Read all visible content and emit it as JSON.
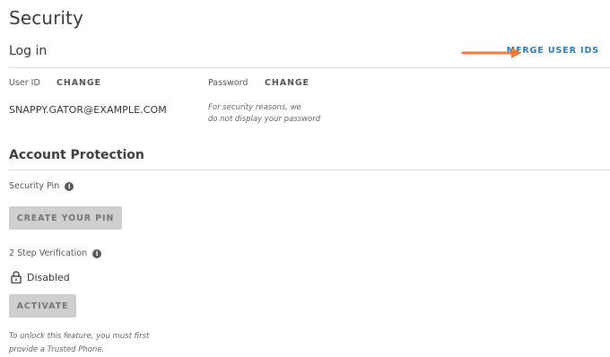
{
  "page": {
    "title": "Security"
  },
  "login": {
    "title": "Log in",
    "merge_link": "MERGE USER IDS",
    "user_id_label": "User ID",
    "user_id_change": "CHANGE",
    "password_label": "Password",
    "password_change": "CHANGE",
    "user_email": "SNAPPY.GATOR@EXAMPLE.COM",
    "password_note_line1": "For security reasons, we",
    "password_note_line2": "do not display your password"
  },
  "protection": {
    "title": "Account Protection",
    "security_pin_label": "Security Pin",
    "create_pin_button": "CREATE YOUR PIN",
    "two_step_label": "2 Step Verification",
    "status": "Disabled",
    "activate_button": "ACTIVATE",
    "unlock_note_line1": "To unlock this feature, you must first",
    "unlock_note_line2": "provide a Trusted Phone."
  },
  "colors": {
    "link": "#2b7bbf",
    "arrow": "#f07a35",
    "button_bg": "#cfcfcf",
    "divider": "#dcdcdc"
  },
  "icons": {
    "info": "info-icon",
    "lock": "lock-icon",
    "arrow": "arrow-right-icon"
  }
}
